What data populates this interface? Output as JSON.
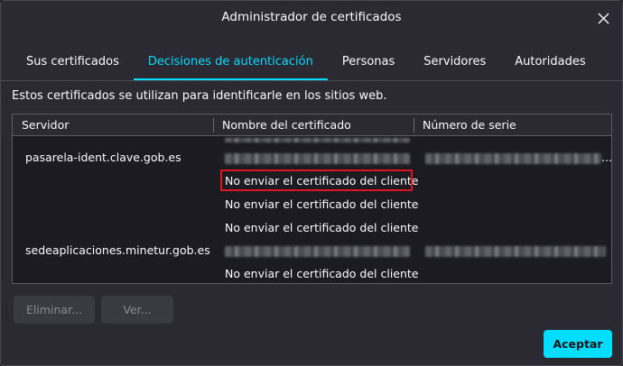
{
  "window": {
    "title": "Administrador de certificados"
  },
  "tabs": [
    {
      "label": "Sus certificados",
      "selected": false
    },
    {
      "label": "Decisiones de autenticación",
      "selected": true
    },
    {
      "label": "Personas",
      "selected": false
    },
    {
      "label": "Servidores",
      "selected": false
    },
    {
      "label": "Autoridades",
      "selected": false
    }
  ],
  "description": "Estos certificados se utilizan para identificarle en los sitios web.",
  "table": {
    "columns": [
      "Servidor",
      "Nombre del certificado",
      "Número de serie"
    ],
    "rows": [
      {
        "server": "pasarela-ident.clave.gob.es",
        "certificate": "",
        "serial": ""
      },
      {
        "server": "",
        "certificate": "No enviar el certificado del cliente",
        "serial": ""
      },
      {
        "server": "",
        "certificate": "No enviar el certificado del cliente",
        "serial": ""
      },
      {
        "server": "",
        "certificate": "No enviar el certificado del cliente",
        "serial": ""
      },
      {
        "server": "sedeaplicaciones.minetur.gob.es",
        "certificate": "",
        "serial": ""
      },
      {
        "server": "",
        "certificate": "No enviar el certificado del cliente",
        "serial": ""
      }
    ],
    "overflow_indicator": "..."
  },
  "buttons": {
    "delete": "Eliminar...",
    "view": "Ver...",
    "accept": "Aceptar"
  },
  "colors": {
    "accent": "#00ddff",
    "highlight": "#e0141e"
  }
}
